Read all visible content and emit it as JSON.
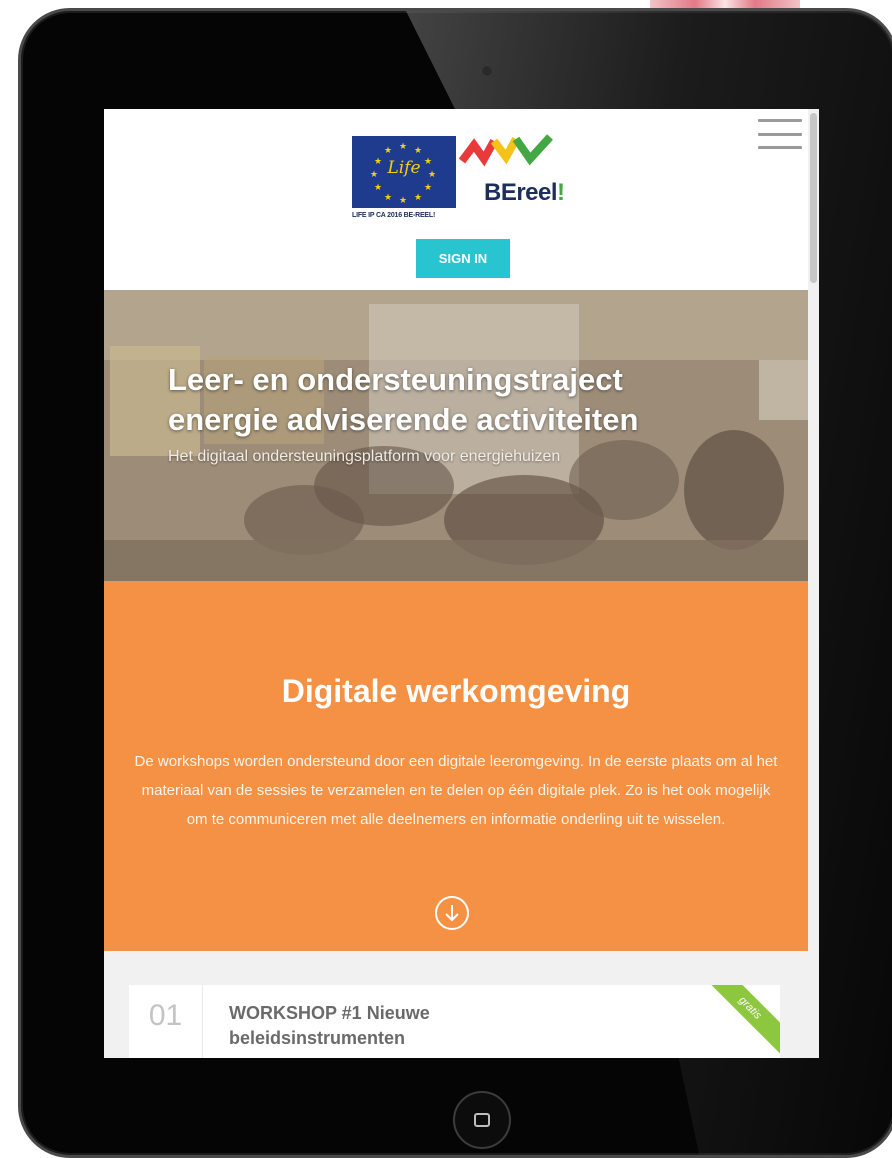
{
  "header": {
    "eu_logo_caption": "LIFE IP CA 2016 BE-REEL!",
    "eu_logo_word": "Life",
    "brand_name_main": "BEreel",
    "brand_name_mark": "!",
    "signin_label": "SIGN IN"
  },
  "hero": {
    "title_line1": "Leer- en ondersteuningstraject",
    "title_line2": "energie adviserende activiteiten",
    "subtitle": "Het digitaal ondersteuningsplatform voor energiehuizen"
  },
  "intro": {
    "heading": "Digitale werkomgeving",
    "body": "De workshops worden ondersteund door een digitale leeromgeving. In de eerste plaats om  al het materiaal van de sessies te verzamelen en te delen op één digitale plek. Zo is het ook mogelijk om te communiceren met alle deelnemers en informatie onderling uit te wisselen."
  },
  "workshops": [
    {
      "number": "01",
      "title": "WORKSHOP #1 Nieuwe beleidsinstrumenten",
      "badge": "gratis"
    }
  ],
  "colors": {
    "accent_orange": "#f59144",
    "signin_teal": "#28c4cf",
    "badge_green": "#8dc63f"
  },
  "icons": [
    "menu-icon",
    "arrow-down-circle-icon",
    "home-button-icon"
  ]
}
